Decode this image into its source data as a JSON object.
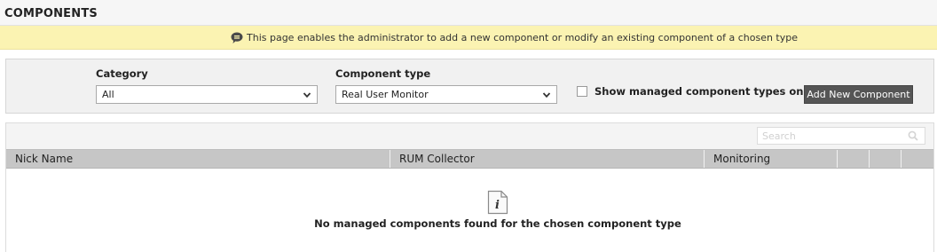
{
  "page": {
    "title": "COMPONENTS"
  },
  "banner": {
    "text": "This page enables the administrator to add a new component or modify an existing component of a chosen type",
    "icon": "speech-bubble-icon"
  },
  "filters": {
    "category": {
      "label": "Category",
      "value": "All"
    },
    "component_type": {
      "label": "Component type",
      "value": "Real User Monitor"
    },
    "show_managed": {
      "label": "Show managed component types only",
      "checked": false
    },
    "add_button_label": "Add New Component"
  },
  "table": {
    "search_placeholder": "Search",
    "columns": [
      "Nick Name",
      "RUM Collector",
      "Monitoring",
      "",
      "",
      ""
    ],
    "rows": [],
    "empty_message": "No managed components found for the chosen component type",
    "header_color": "#c6c6c6"
  },
  "colors": {
    "banner": "#fbf3b2",
    "button": "#555555"
  }
}
